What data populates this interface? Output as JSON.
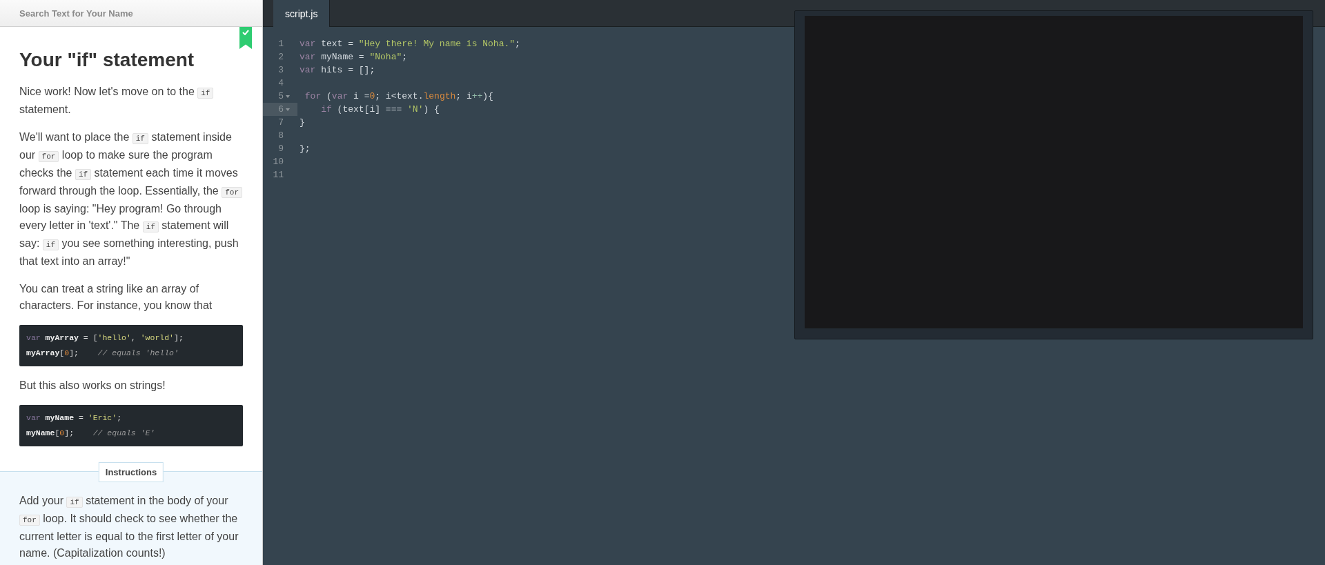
{
  "lesson": {
    "header": "Search Text for Your Name",
    "completed": true,
    "title": "Your \"if\" statement",
    "body": [
      {
        "kind": "para",
        "segments": [
          {
            "kind": "text",
            "text": "Nice work! Now let's move on to the "
          },
          {
            "kind": "code",
            "text": "if"
          },
          {
            "kind": "text",
            "text": " statement."
          }
        ]
      },
      {
        "kind": "para",
        "segments": [
          {
            "kind": "text",
            "text": "We'll want to place the "
          },
          {
            "kind": "code",
            "text": "if"
          },
          {
            "kind": "text",
            "text": " statement inside our "
          },
          {
            "kind": "code",
            "text": "for"
          },
          {
            "kind": "text",
            "text": " loop to make sure the program checks the "
          },
          {
            "kind": "code",
            "text": "if"
          },
          {
            "kind": "text",
            "text": " statement each time it moves forward through the loop. Essentially, the "
          },
          {
            "kind": "code",
            "text": "for"
          },
          {
            "kind": "text",
            "text": " loop is saying: \"Hey program! Go through every letter in 'text'.\" The "
          },
          {
            "kind": "code",
            "text": "if"
          },
          {
            "kind": "text",
            "text": " statement will say: "
          },
          {
            "kind": "code",
            "text": "if"
          },
          {
            "kind": "text",
            "text": " you see something interesting, push that text into an array!\""
          }
        ]
      },
      {
        "kind": "para",
        "segments": [
          {
            "kind": "text",
            "text": "You can treat a string like an array of characters. For instance, you know that"
          }
        ]
      },
      {
        "kind": "code",
        "lines": [
          [
            {
              "kind": "keyword",
              "text": "var"
            },
            {
              "kind": "name",
              "text": " myArray"
            },
            {
              "kind": "plain",
              "text": " = ["
            },
            {
              "kind": "string",
              "text": "'hello'"
            },
            {
              "kind": "plain",
              "text": ", "
            },
            {
              "kind": "string",
              "text": "'world'"
            },
            {
              "kind": "plain",
              "text": "];"
            }
          ],
          [
            {
              "kind": "name",
              "text": "myArray"
            },
            {
              "kind": "plain",
              "text": "["
            },
            {
              "kind": "number",
              "text": "0"
            },
            {
              "kind": "plain",
              "text": "];    "
            },
            {
              "kind": "comment",
              "text": "// equals 'hello'"
            }
          ]
        ]
      },
      {
        "kind": "para",
        "segments": [
          {
            "kind": "text",
            "text": "But this also works on strings!"
          }
        ]
      },
      {
        "kind": "code",
        "lines": [
          [
            {
              "kind": "keyword",
              "text": "var"
            },
            {
              "kind": "name",
              "text": " myName"
            },
            {
              "kind": "plain",
              "text": " = "
            },
            {
              "kind": "string",
              "text": "'Eric'"
            },
            {
              "kind": "plain",
              "text": ";"
            }
          ],
          [
            {
              "kind": "name",
              "text": "myName"
            },
            {
              "kind": "plain",
              "text": "["
            },
            {
              "kind": "number",
              "text": "0"
            },
            {
              "kind": "plain",
              "text": "];    "
            },
            {
              "kind": "comment",
              "text": "// equals 'E'"
            }
          ]
        ]
      }
    ],
    "instructions_label": "Instructions",
    "instructions": [
      {
        "kind": "text",
        "text": "Add your "
      },
      {
        "kind": "code",
        "text": "if"
      },
      {
        "kind": "text",
        "text": " statement in the body of your "
      },
      {
        "kind": "code",
        "text": "for"
      },
      {
        "kind": "text",
        "text": " loop. It should check to see whether the current letter is equal to the first letter of your name. (Capitalization counts!)"
      }
    ]
  },
  "editor": {
    "tabs": [
      {
        "label": "script.js",
        "selected": true
      }
    ],
    "lines": [
      {
        "number": "1",
        "active": false,
        "foldable": false,
        "tokens": [
          {
            "kind": "keyword",
            "text": "var"
          },
          {
            "kind": "plain",
            "text": " text = "
          },
          {
            "kind": "string",
            "text": "\"Hey there! My name is Noha.\""
          },
          {
            "kind": "plain",
            "text": ";"
          }
        ]
      },
      {
        "number": "2",
        "active": false,
        "foldable": false,
        "tokens": [
          {
            "kind": "keyword",
            "text": "var"
          },
          {
            "kind": "plain",
            "text": " myName = "
          },
          {
            "kind": "string",
            "text": "\"Noha\""
          },
          {
            "kind": "plain",
            "text": ";"
          }
        ]
      },
      {
        "number": "3",
        "active": false,
        "foldable": false,
        "tokens": [
          {
            "kind": "keyword",
            "text": "var"
          },
          {
            "kind": "plain",
            "text": " hits = [];"
          }
        ]
      },
      {
        "number": "4",
        "active": false,
        "foldable": false
      },
      {
        "number": "5",
        "active": false,
        "foldable": true,
        "tokens": [
          {
            "kind": "keyword",
            "text": " for"
          },
          {
            "kind": "plain",
            "text": " ("
          },
          {
            "kind": "keyword",
            "text": "var"
          },
          {
            "kind": "plain",
            "text": " i ="
          },
          {
            "kind": "number",
            "text": "0"
          },
          {
            "kind": "plain",
            "text": "; i<text."
          },
          {
            "kind": "prop",
            "text": "length"
          },
          {
            "kind": "plain",
            "text": "; i"
          },
          {
            "kind": "op",
            "text": "++"
          },
          {
            "kind": "plain",
            "text": "){"
          }
        ]
      },
      {
        "number": "6",
        "active": true,
        "foldable": true,
        "tokens": [
          {
            "kind": "keyword",
            "text": "    if"
          },
          {
            "kind": "plain",
            "text": " (text[i] === "
          },
          {
            "kind": "string",
            "text": "'N'"
          },
          {
            "kind": "plain",
            "text": ") {"
          }
        ]
      },
      {
        "number": "7",
        "active": false,
        "foldable": false,
        "tokens": [
          {
            "kind": "plain",
            "text": "}"
          }
        ]
      },
      {
        "number": "8",
        "active": false,
        "foldable": false
      },
      {
        "number": "9",
        "active": false,
        "foldable": false,
        "tokens": [
          {
            "kind": "plain",
            "text": "};"
          }
        ]
      },
      {
        "number": "10",
        "active": false,
        "foldable": false
      },
      {
        "number": "11",
        "active": false,
        "foldable": false
      }
    ]
  }
}
